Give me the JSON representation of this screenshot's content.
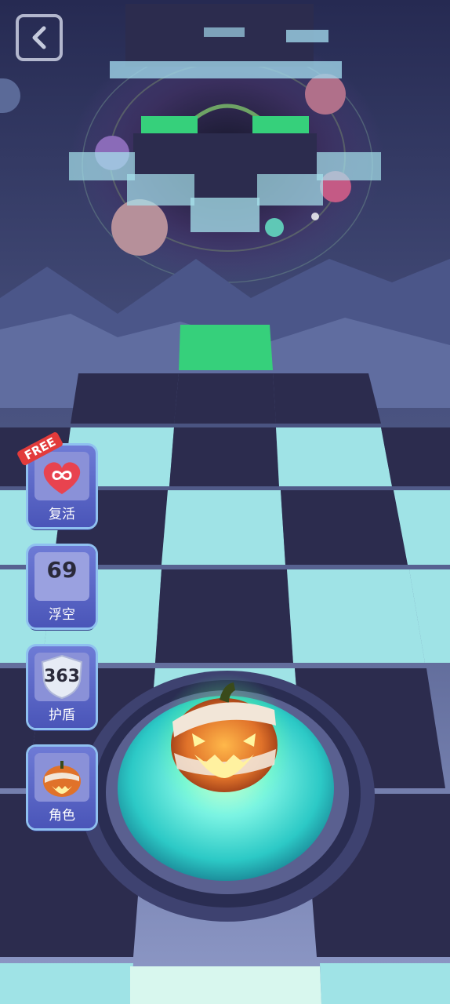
{
  "nav": {
    "back_icon": "back-arrow-icon"
  },
  "powerups": [
    {
      "badge": "FREE",
      "value": "",
      "label": "复活",
      "icon": "heart-infinity-icon"
    },
    {
      "badge": "",
      "value": "69",
      "label": "浮空",
      "icon": "wing-icon"
    },
    {
      "badge": "",
      "value": "363",
      "label": "护盾",
      "icon": "shield-icon"
    },
    {
      "badge": "",
      "value": "",
      "label": "角色",
      "icon": "pumpkin-icon"
    }
  ],
  "colors": {
    "sky_top": "#2b2d57",
    "sky_bottom": "#7c86b8",
    "tile_dark": "#2c2c4e",
    "tile_light": "#9fe3e6",
    "tile_green": "#36d07b",
    "glow": "#52f0e0",
    "pumpkin": "#e0722a"
  }
}
